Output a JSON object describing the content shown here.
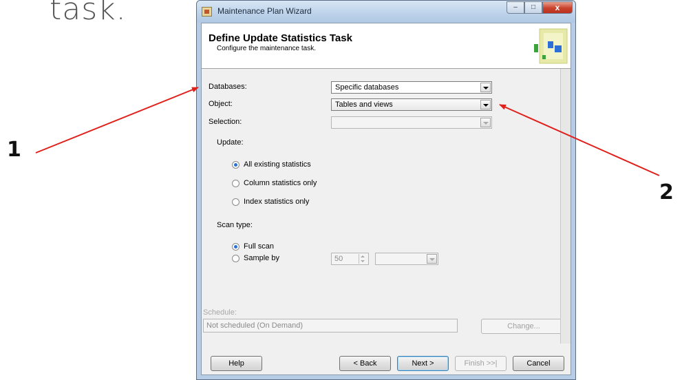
{
  "slide": {
    "text": "task.",
    "callouts": [
      "1",
      "2"
    ],
    "arrow_color": "#e0201b"
  },
  "window": {
    "title": "Maintenance Plan Wizard",
    "controls": {
      "minimize": "–",
      "maximize": "□",
      "close": "x"
    }
  },
  "header": {
    "title": "Define Update Statistics Task",
    "subtitle": "Configure the maintenance task."
  },
  "form": {
    "databases_label": "Databases:",
    "databases_value": "Specific databases",
    "object_label": "Object:",
    "object_value": "Tables and views",
    "selection_label": "Selection:",
    "selection_value": "",
    "update_label": "Update:",
    "update_options": [
      "All existing statistics",
      "Column statistics only",
      "Index statistics only"
    ],
    "update_selected": "All existing statistics",
    "scan_type_label": "Scan type:",
    "scan_options": [
      "Full scan",
      "Sample by"
    ],
    "scan_selected": "Full scan",
    "sample_value": "50",
    "sample_unit": ""
  },
  "schedule": {
    "label": "Schedule:",
    "value": "Not scheduled (On Demand)",
    "change_button": "Change..."
  },
  "buttons": {
    "help": "Help",
    "back": "< Back",
    "next": "Next >",
    "finish": "Finish >>|",
    "cancel": "Cancel"
  }
}
